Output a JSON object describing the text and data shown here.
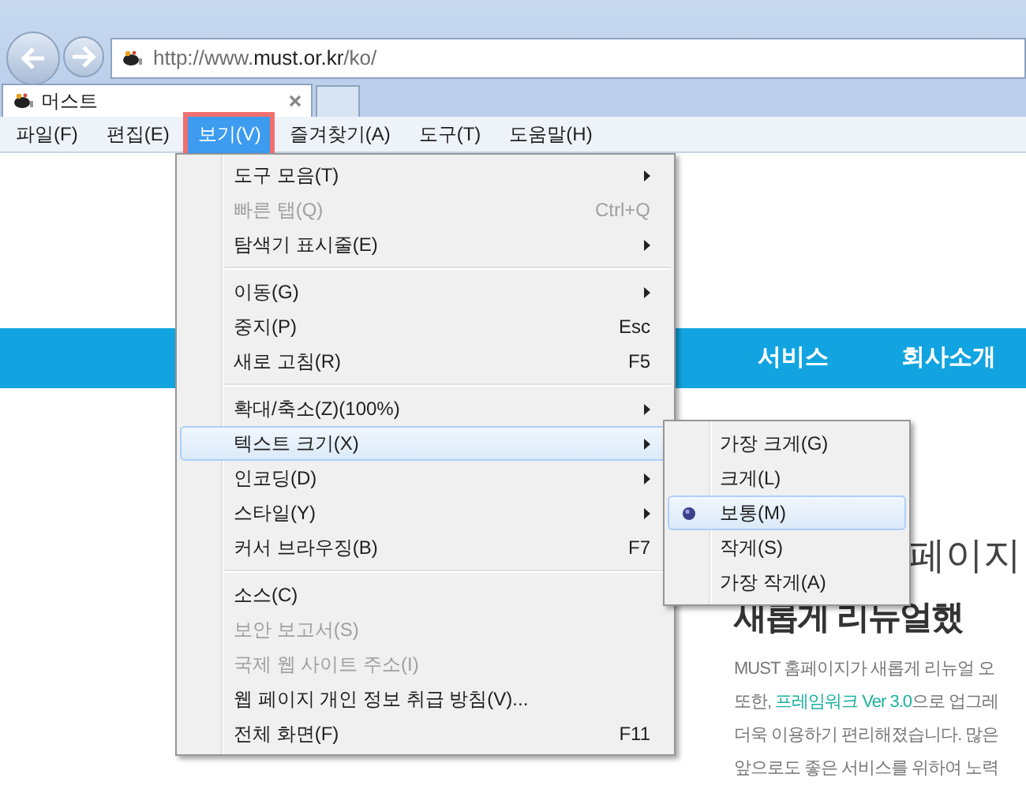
{
  "address_bar": {
    "prefix": "http://www.",
    "domain": "must.or.kr",
    "path": "/ko/"
  },
  "tabs": [
    {
      "title": "머스트",
      "selected": true
    }
  ],
  "menu_bar": [
    {
      "label": "파일(F)",
      "selected": false
    },
    {
      "label": "편집(E)",
      "selected": false
    },
    {
      "label": "보기(V)",
      "selected": true
    },
    {
      "label": "즐겨찾기(A)",
      "selected": false
    },
    {
      "label": "도구(T)",
      "selected": false
    },
    {
      "label": "도움말(H)",
      "selected": false
    }
  ],
  "view_menu": [
    {
      "kind": "item",
      "label": "도구 모음(T)",
      "submenu": true,
      "disabled": false,
      "selected": false
    },
    {
      "kind": "item",
      "label": "빠른 탭(Q)",
      "shortcut": "Ctrl+Q",
      "submenu": false,
      "disabled": true,
      "selected": false
    },
    {
      "kind": "item",
      "label": "탐색기 표시줄(E)",
      "submenu": true,
      "disabled": false,
      "selected": false
    },
    {
      "kind": "separator"
    },
    {
      "kind": "item",
      "label": "이동(G)",
      "submenu": true,
      "disabled": false,
      "selected": false
    },
    {
      "kind": "item",
      "label": "중지(P)",
      "shortcut": "Esc",
      "submenu": false,
      "disabled": false,
      "selected": false
    },
    {
      "kind": "item",
      "label": "새로 고침(R)",
      "shortcut": "F5",
      "submenu": false,
      "disabled": false,
      "selected": false
    },
    {
      "kind": "separator"
    },
    {
      "kind": "item",
      "label": "확대/축소(Z)(100%)",
      "submenu": true,
      "disabled": false,
      "selected": false
    },
    {
      "kind": "item",
      "label": "텍스트 크기(X)",
      "submenu": true,
      "disabled": false,
      "selected": true
    },
    {
      "kind": "item",
      "label": "인코딩(D)",
      "submenu": true,
      "disabled": false,
      "selected": false
    },
    {
      "kind": "item",
      "label": "스타일(Y)",
      "submenu": true,
      "disabled": false,
      "selected": false
    },
    {
      "kind": "item",
      "label": "커서 브라우징(B)",
      "shortcut": "F7",
      "submenu": false,
      "disabled": false,
      "selected": false
    },
    {
      "kind": "separator"
    },
    {
      "kind": "item",
      "label": "소스(C)",
      "submenu": false,
      "disabled": false,
      "selected": false
    },
    {
      "kind": "item",
      "label": "보안 보고서(S)",
      "submenu": false,
      "disabled": true,
      "selected": false
    },
    {
      "kind": "item",
      "label": "국제 웹 사이트 주소(I)",
      "submenu": false,
      "disabled": true,
      "selected": false
    },
    {
      "kind": "item",
      "label": "웹 페이지 개인 정보 취급 방침(V)...",
      "submenu": false,
      "disabled": false,
      "selected": false
    },
    {
      "kind": "item",
      "label": "전체 화면(F)",
      "shortcut": "F11",
      "submenu": false,
      "disabled": false,
      "selected": false
    }
  ],
  "text_size_menu": [
    {
      "label": "가장 크게(G)",
      "selected": false
    },
    {
      "label": "크게(L)",
      "selected": false
    },
    {
      "label": "보통(M)",
      "selected": true
    },
    {
      "label": "작게(S)",
      "selected": false
    },
    {
      "label": "가장 작게(A)",
      "selected": false
    }
  ],
  "site_nav": [
    "서비스",
    "회사소개"
  ],
  "headline": [
    "페이지",
    "새롭게 리뉴얼했"
  ],
  "paragraph": [
    {
      "text": "MUST 홈페이지가 새롭게 리뉴얼 오"
    },
    {
      "text": "또한, ",
      "link": "프레임워크 Ver 3.0",
      "after": "으로 업그레"
    },
    {
      "text": "더욱 이용하기 편리해졌습니다. 많은"
    },
    {
      "text": "앞으로도 좋은 서비스를 위하여 노력"
    }
  ]
}
